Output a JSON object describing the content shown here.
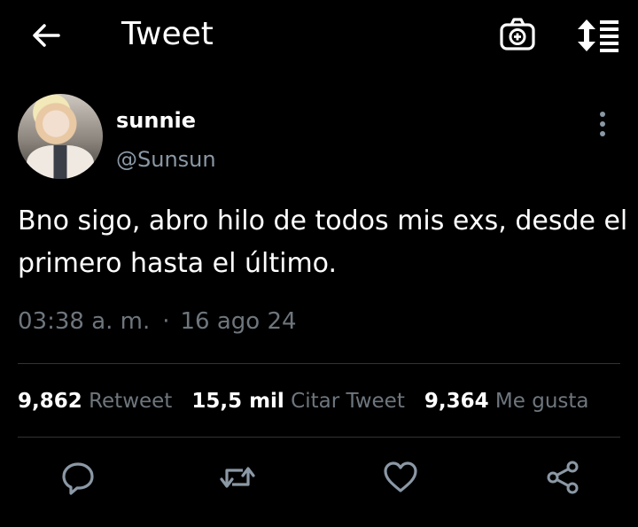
{
  "header": {
    "title": "Tweet",
    "back_icon": "arrow-left-icon",
    "camera_icon": "camera-add-icon",
    "sort_icon": "sort-icon"
  },
  "tweet": {
    "display_name": "sunnie",
    "handle": "@Sunsun",
    "text": "Bno sigo, abro hilo de todos mis exs, desde el primero hasta el último.",
    "time": "03:38 a. m.",
    "separator": "·",
    "date": "16 ago 24"
  },
  "stats": {
    "retweets_count": "9,862",
    "retweets_label": "Retweet",
    "quotes_count": "15,5 mil",
    "quotes_label": "Citar Tweet",
    "likes_count": "9,364",
    "likes_label": "Me gusta"
  },
  "actions": [
    "reply-icon",
    "retweet-icon",
    "like-icon",
    "share-icon"
  ],
  "colors": {
    "background": "#000000",
    "text": "#ffffff",
    "secondary": "#6e767d",
    "icon": "#8b98a5",
    "divider": "#2f3336"
  }
}
